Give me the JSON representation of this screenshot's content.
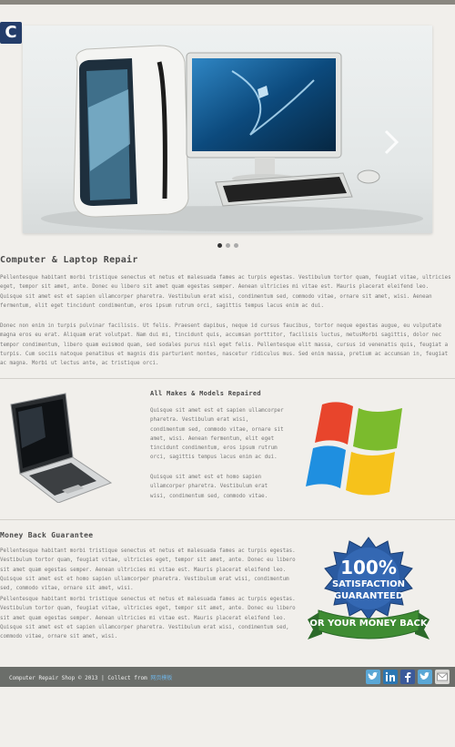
{
  "header": {
    "logo_letter": "C"
  },
  "slider": {
    "dots": 3,
    "active_dot": 1
  },
  "main": {
    "heading": "Computer & Laptop Repair",
    "paragraphs": [
      "Pellentesque habitant morbi tristique senectus et netus et malesuada fames ac turpis egestas. Vestibulum tortor quam, feugiat vitae, ultricies eget, tempor sit amet, ante. Donec eu libero sit amet quam egestas semper. Aenean ultricies mi vitae est. Mauris placerat eleifend leo. Quisque sit amet est et sapien ullamcorper pharetra. Vestibulum erat wisi, condimentum sed, commodo vitae, ornare sit amet, wisi. Aenean fermentum, elit eget tincidunt condimentum, eros ipsum rutrum orci, sagittis tempus lacus enim ac dui.",
      "Donec non enim in turpis pulvinar facilisis. Ut felis. Praesent dapibus, neque id cursus faucibus, tortor neque egestas augue, eu vulputate magna eros eu erat. Aliquam erat volutpat. Nam dui mi, tincidunt quis, accumsan porttitor, facilisis luctus, metusMorbi sagittis, dolor nec tempor condimentum, libero quam euismod quam, sed sodales purus nisl eget felis. Pellentesque elit massa, cursus id venenatis quis, feugiat a turpis. Cum sociis natoque penatibus et magnis dis parturient montes, nascetur ridiculus mus. Sed enim massa, pretium ac accumsan in, feugiat ac magna. Morbi ut lectus ante, ac tristique orci."
    ]
  },
  "makes": {
    "heading": "All Makes & Models Repaired",
    "paragraphs": [
      "Quisque sit amet est et sapien ullamcorper pharetra. Vestibulum erat wisi, condimentum sed, commodo vitae, ornare sit amet, wisi. Aenean fermentum, elit eget tincidunt condimentum, eros ipsum rutrum orci, sagittis tempus lacus enim ac dui.",
      "Quisque sit amet est et homo sapien ullamcorper pharetra. Vestibulum erat wisi, condimentum sed, commodo vitae."
    ]
  },
  "money": {
    "heading": "Money Back Guarantee",
    "paragraphs": [
      "Pellentesque habitant morbi tristique senectus et netus et malesuada fames ac turpis egestas. Vestibulum tortor quam, feugiat vitae, ultricies eget, tempor sit amet, ante. Donec eu libero sit amet quam egestas semper. Aenean ultricies mi vitae est. Mauris placerat eleifend leo. Quisque sit amet est et homo sapien ullamcorper pharetra. Vestibulum erat wisi, condimentum sed, commodo vitae, ornare sit amet, wisi.",
      "Pellentesque habitant morbi tristique senectus et netus et malesuada fames ac turpis egestas. Vestibulum tortor quam, feugiat vitae, ultricies eget, tempor sit amet, ante. Donec eu libero sit amet quam egestas semper. Aenean ultricies mi vitae est. Mauris placerat eleifend leo. Quisque sit amet est et sapien ullamcorper pharetra. Vestibulum erat wisi, condimentum sed, commodo vitae, ornare sit amet, wisi."
    ],
    "seal": {
      "line1": "100%",
      "line2": "SATISFACTION",
      "line3": "GUARANTEED",
      "ribbon": "OR YOUR MONEY BACK"
    }
  },
  "footer": {
    "text": "Computer Repair Shop © 2013 | Collect from ",
    "link": "网页模板",
    "social_icons": [
      "twitter-icon",
      "linkedin-icon",
      "facebook-icon",
      "twitter-icon",
      "mail-icon"
    ]
  },
  "colors": {
    "background": "#f1efeb",
    "footer": "#6b6e6a",
    "link": "#6fb3e3",
    "logo": "#243d6a"
  }
}
